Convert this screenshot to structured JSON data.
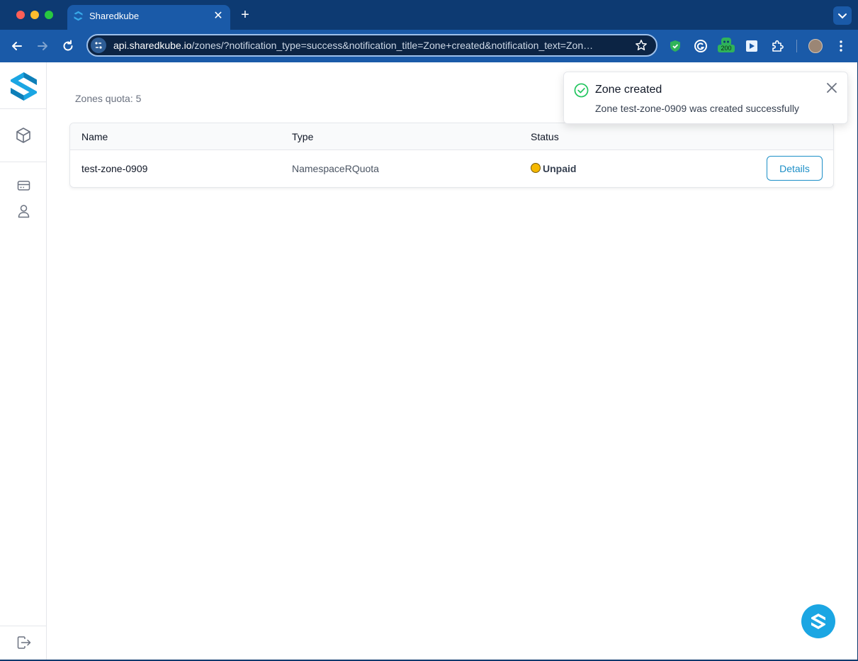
{
  "browser": {
    "tab_title": "Sharedkube",
    "new_tab_label": "+",
    "tab_close_label": "✕",
    "url_host": "api.sharedkube.io",
    "url_path": "/zones/?notification_type=success&notification_title=Zone+created&notification_text=Zon…",
    "extension_badge": "200"
  },
  "page": {
    "zones_quota": "Zones quota: 5",
    "table": {
      "headers": [
        "Name",
        "Type",
        "Status"
      ],
      "rows": [
        {
          "name": "test-zone-0909",
          "type": "NamespaceRQuota",
          "status": "Unpaid",
          "action": "Details"
        }
      ]
    }
  },
  "notification": {
    "title": "Zone created",
    "text": "Zone test-zone-0909 was created successfully"
  },
  "colors": {
    "brand": "#1ba6e3",
    "status_unpaid": "#f5b800",
    "success": "#22c55e"
  }
}
